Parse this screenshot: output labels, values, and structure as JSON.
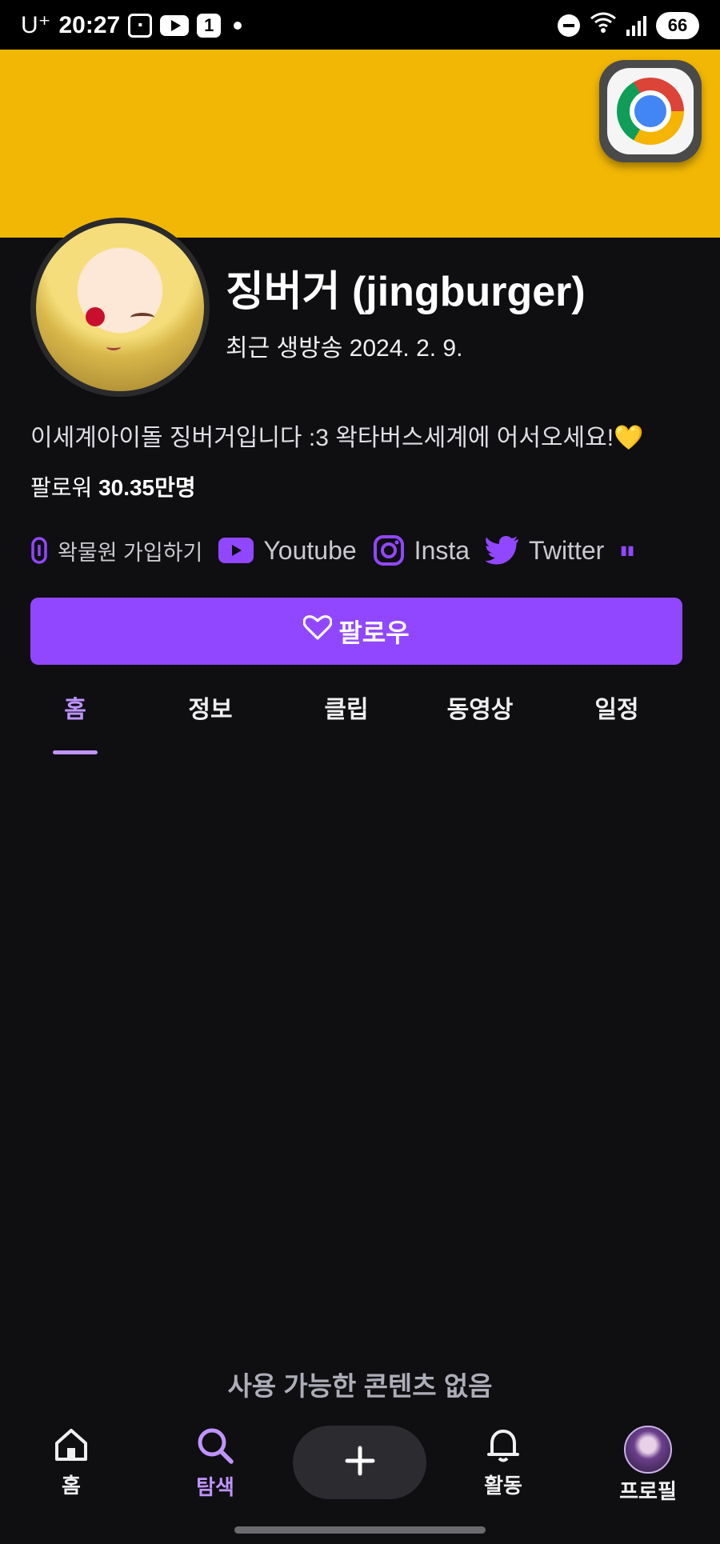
{
  "status_bar": {
    "carrier": "U⁺",
    "time": "20:27",
    "notif_badge": "1",
    "battery": "66"
  },
  "channel": {
    "name": "징버거 (jingburger)",
    "last_live": "최근 생방송 2024. 2. 9.",
    "bio": "이세계아이돌 징버거입니다 :3 왁타버스세계에 어서오세요!💛",
    "followers_label": "팔로워",
    "followers_count": "30.35만명",
    "banner_color": "#f2b705"
  },
  "links": [
    {
      "label": "왁물원 가입하기",
      "icon": "link-icon"
    },
    {
      "label": "Youtube",
      "icon": "youtube-icon"
    },
    {
      "label": "Insta",
      "icon": "instagram-icon"
    },
    {
      "label": "Twitter",
      "icon": "twitter-icon"
    }
  ],
  "follow_button": {
    "label": "팔로우",
    "icon": "heart-icon",
    "color": "#9147ff"
  },
  "tabs": [
    {
      "label": "홈",
      "active": true
    },
    {
      "label": "정보"
    },
    {
      "label": "클립"
    },
    {
      "label": "동영상"
    },
    {
      "label": "일정"
    }
  ],
  "empty_message": "사용 가능한 콘텐츠 없음",
  "bottom_nav": {
    "home": "홈",
    "search": "탐색",
    "activity": "활동",
    "profile": "프로필",
    "active": "search"
  },
  "accent_color": "#bf94ff"
}
